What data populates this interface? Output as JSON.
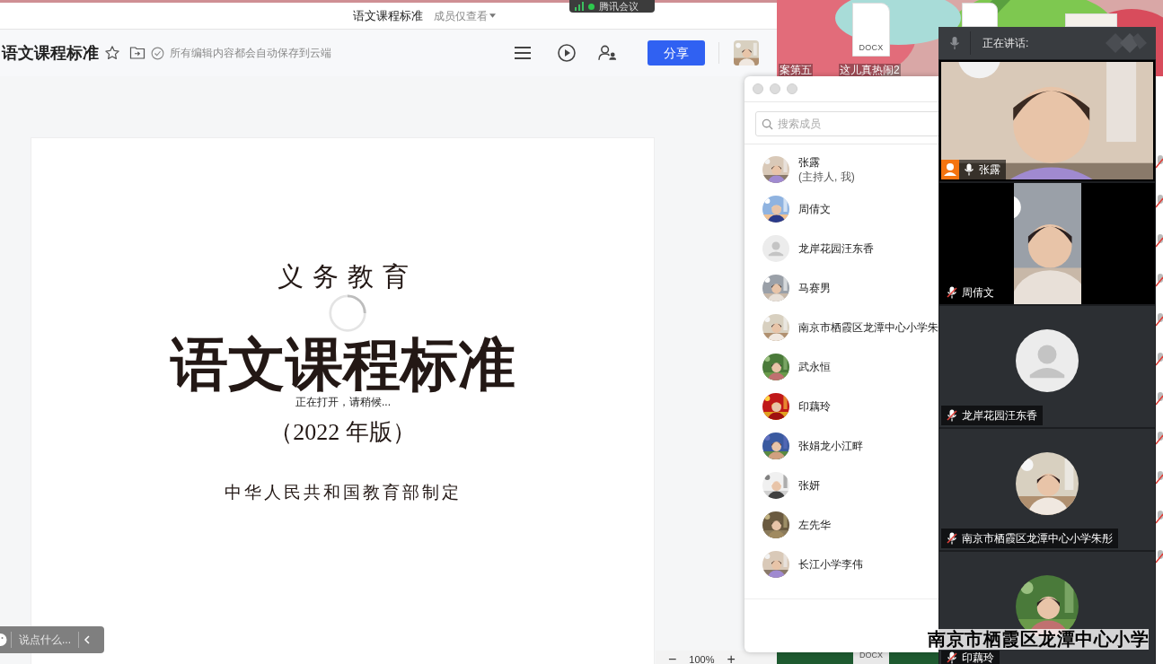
{
  "meeting_indicator": {
    "label": "腾讯会议"
  },
  "desktop": {
    "files": [
      {
        "label": "案第五"
      },
      {
        "label": "这儿真热闹2",
        "type_label": "DOCX"
      }
    ],
    "bottom_file": {
      "type_label": "DOCX"
    }
  },
  "document_window": {
    "title": "语文课程标准",
    "permission": "成员仅查看",
    "toolbar": {
      "doc_title": "语文课程标准",
      "save_status": "所有编辑内容都会自动保存到云端",
      "share_button": "分享"
    },
    "page": {
      "lines": [
        "义务教育",
        "语文课程标准",
        "（2022 年版）",
        "中华人民共和国教育部制定"
      ],
      "loading_text": "正在打开，请稍候..."
    },
    "chat": {
      "placeholder": "说点什么..."
    },
    "zoom": {
      "value": "100%",
      "minus": "−",
      "plus": "+"
    }
  },
  "members_window": {
    "search": {
      "placeholder": "搜索成员"
    },
    "members": [
      {
        "name": "张露",
        "note": "(主持人, 我)"
      },
      {
        "name": "周倩文"
      },
      {
        "name": "龙岸花园汪东香",
        "kind": "default"
      },
      {
        "name": "马赛男"
      },
      {
        "name": "南京市栖霞区龙潭中心小学朱"
      },
      {
        "name": "武永恒"
      },
      {
        "name": "印藕玲"
      },
      {
        "name": "张娟龙小江畔"
      },
      {
        "name": "张妍"
      },
      {
        "name": "左先华"
      },
      {
        "name": "长江小学李伟"
      }
    ]
  },
  "meeting_panel": {
    "speaking_label": "正在讲话:",
    "tiles": [
      {
        "name": "张露",
        "kind": "video",
        "host": true,
        "muted": false
      },
      {
        "name": "周倩文",
        "kind": "portrait_video",
        "host": false,
        "muted": true
      },
      {
        "name": "龙岸花园汪东香",
        "kind": "default_avatar",
        "host": false,
        "muted": true
      },
      {
        "name": "南京市栖霞区龙潭中心小学朱彤",
        "kind": "photo_avatar",
        "host": false,
        "muted": true
      },
      {
        "name": "印藕玲",
        "kind": "photo_avatar",
        "host": false,
        "muted": true
      }
    ]
  },
  "overlay_caption": "南京市栖霞区龙潭中心小学"
}
